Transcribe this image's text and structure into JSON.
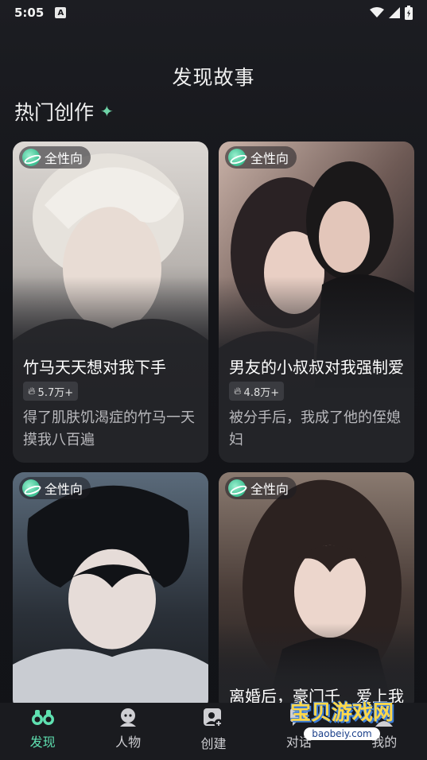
{
  "status_bar": {
    "time": "5:05",
    "notif": "A"
  },
  "header": {
    "title": "发现故事"
  },
  "section": {
    "title": "热门创作"
  },
  "cards": [
    {
      "tag": "全性向",
      "title": "竹马天天想对我下手",
      "heat": "5.7万+",
      "desc": "得了肌肤饥渴症的竹马一天摸我八百遍"
    },
    {
      "tag": "全性向",
      "title": "男友的小叔叔对我强制爱",
      "heat": "4.8万+",
      "desc": "被分手后，我成了他的侄媳妇"
    },
    {
      "tag": "全性向",
      "title": "",
      "heat": "",
      "desc": ""
    },
    {
      "tag": "全性向",
      "title": "离婚后，豪门千　爱上我",
      "heat": "",
      "desc": ""
    }
  ],
  "nav": [
    {
      "label": "发现",
      "icon": "binoculars-icon"
    },
    {
      "label": "人物",
      "icon": "character-icon"
    },
    {
      "label": "创建",
      "icon": "create-icon"
    },
    {
      "label": "对话",
      "icon": "chat-icon"
    },
    {
      "label": "我的",
      "icon": "profile-icon"
    }
  ],
  "watermark": {
    "main": "宝贝游戏网",
    "sub": "baobeiy.com"
  },
  "colors": {
    "accent": "#5fe0b0",
    "background": "#15161a",
    "card": "#232428"
  }
}
